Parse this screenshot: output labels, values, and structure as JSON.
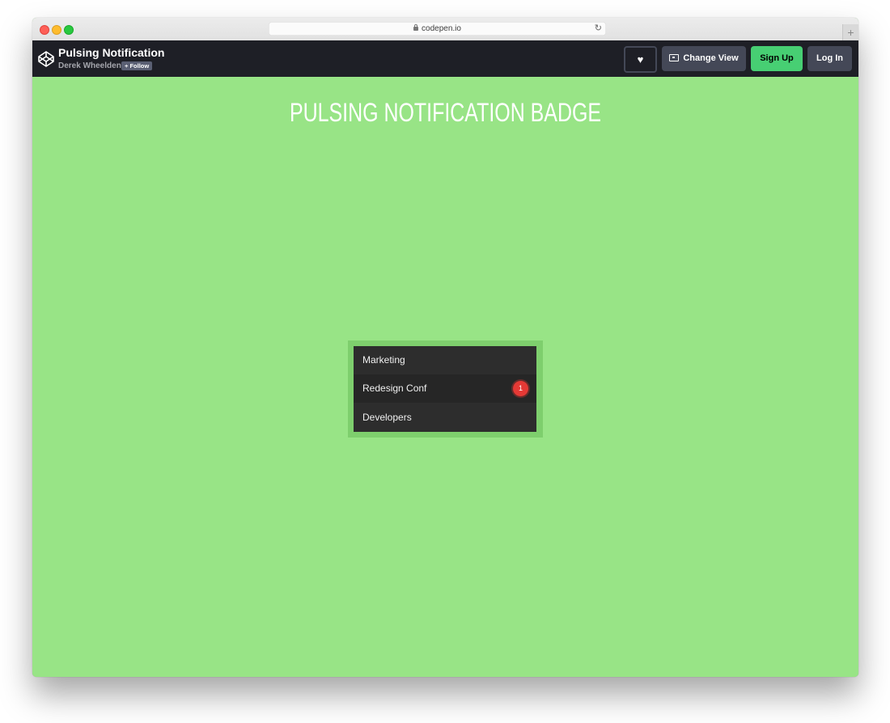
{
  "browser": {
    "url": "codepen.io",
    "lock_icon": "lock-icon",
    "reload_icon": "reload-icon",
    "newtab_symbol": "+"
  },
  "header": {
    "title": "Pulsing Notification",
    "author": "Derek Wheelden",
    "follow_label": "+ Follow",
    "heart_symbol": "♥",
    "change_view_label": "Change View",
    "signup_label": "Sign Up",
    "login_label": "Log In",
    "colors": {
      "bar": "#1e1f26",
      "button": "#444857",
      "signup": "#47cf73"
    }
  },
  "page": {
    "title": "PULSING NOTIFICATION BADGE",
    "background": "#98e486",
    "menu": {
      "items": [
        {
          "label": "Marketing",
          "badge": ""
        },
        {
          "label": "Redesign Conf",
          "badge": "1"
        },
        {
          "label": "Developers",
          "badge": ""
        }
      ],
      "badge_color": "#e53935"
    }
  }
}
